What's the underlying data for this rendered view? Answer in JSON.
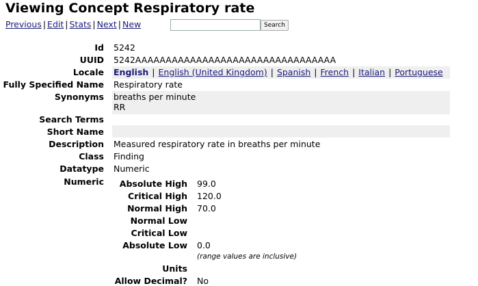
{
  "page": {
    "title": "Viewing Concept Respiratory rate"
  },
  "nav": {
    "links": [
      "Previous",
      "Edit",
      "Stats",
      "Next",
      "New"
    ],
    "separator": "|",
    "search_value": "",
    "search_button": "Search"
  },
  "concept": {
    "id_label": "Id",
    "id": "5242",
    "uuid_label": "UUID",
    "uuid": "5242AAAAAAAAAAAAAAAAAAAAAAAAAAAAAAAAA",
    "locale_label": "Locale",
    "locales": [
      "English",
      "English (United Kingdom)",
      "Spanish",
      "French",
      "Italian",
      "Portuguese"
    ],
    "fsn_label": "Fully Specified Name",
    "fsn": "Respiratory rate",
    "synonyms_label": "Synonyms",
    "synonyms": [
      "breaths per minute",
      "RR"
    ],
    "search_terms_label": "Search Terms",
    "short_name_label": "Short Name",
    "description_label": "Description",
    "description": "Measured respiratory rate in breaths per minute",
    "class_label": "Class",
    "class": "Finding",
    "datatype_label": "Datatype",
    "datatype": "Numeric",
    "numeric_label": "Numeric"
  },
  "numeric": {
    "absolute_high_label": "Absolute High",
    "absolute_high": "99.0",
    "critical_high_label": "Critical High",
    "critical_high": "120.0",
    "normal_high_label": "Normal High",
    "normal_high": "70.0",
    "normal_low_label": "Normal Low",
    "critical_low_label": "Critical Low",
    "absolute_low_label": "Absolute Low",
    "absolute_low": "0.0",
    "range_note": "(range values are inclusive)",
    "units_label": "Units",
    "allow_decimal_label": "Allow Decimal?",
    "allow_decimal": "No"
  }
}
